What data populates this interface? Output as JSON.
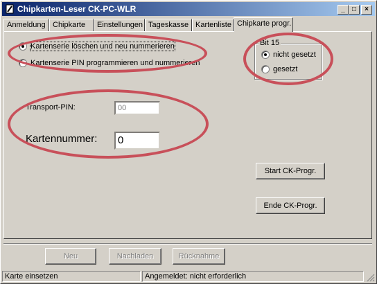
{
  "window": {
    "title": "Chipkarten-Leser CK-PC-WLR"
  },
  "tabs": [
    {
      "label": "Anmeldung"
    },
    {
      "label": "Chipkarte"
    },
    {
      "label": "Einstellungen"
    },
    {
      "label": "Tageskasse"
    },
    {
      "label": "Kartenliste"
    },
    {
      "label": "Chipkarte progr."
    }
  ],
  "mode": {
    "options": [
      {
        "label": "Kartenserie löschen und neu nummerieren",
        "selected": true
      },
      {
        "label": "Kartenserie PIN programmieren und nummerieren",
        "selected": false
      }
    ]
  },
  "bit15": {
    "legend": "Bit 15",
    "options": [
      {
        "label": "nicht gesetzt",
        "selected": true
      },
      {
        "label": "gesetzt",
        "selected": false
      }
    ]
  },
  "transport_pin": {
    "label": "Transport-PIN:",
    "value": "00"
  },
  "kartennummer": {
    "label": "Kartennummer:",
    "value": "0"
  },
  "buttons": {
    "start": "Start CK-Progr.",
    "ende": "Ende CK-Progr.",
    "neu": "Neu",
    "nachladen": "Nachladen",
    "ruecknahme": "Rücknahme"
  },
  "statusbar": {
    "left": "Karte einsetzen",
    "right": "Angemeldet: nicht erforderlich"
  },
  "colors": {
    "titlebar": "#0a246a",
    "annotation": "#c8505a",
    "face": "#d4d0c8"
  }
}
